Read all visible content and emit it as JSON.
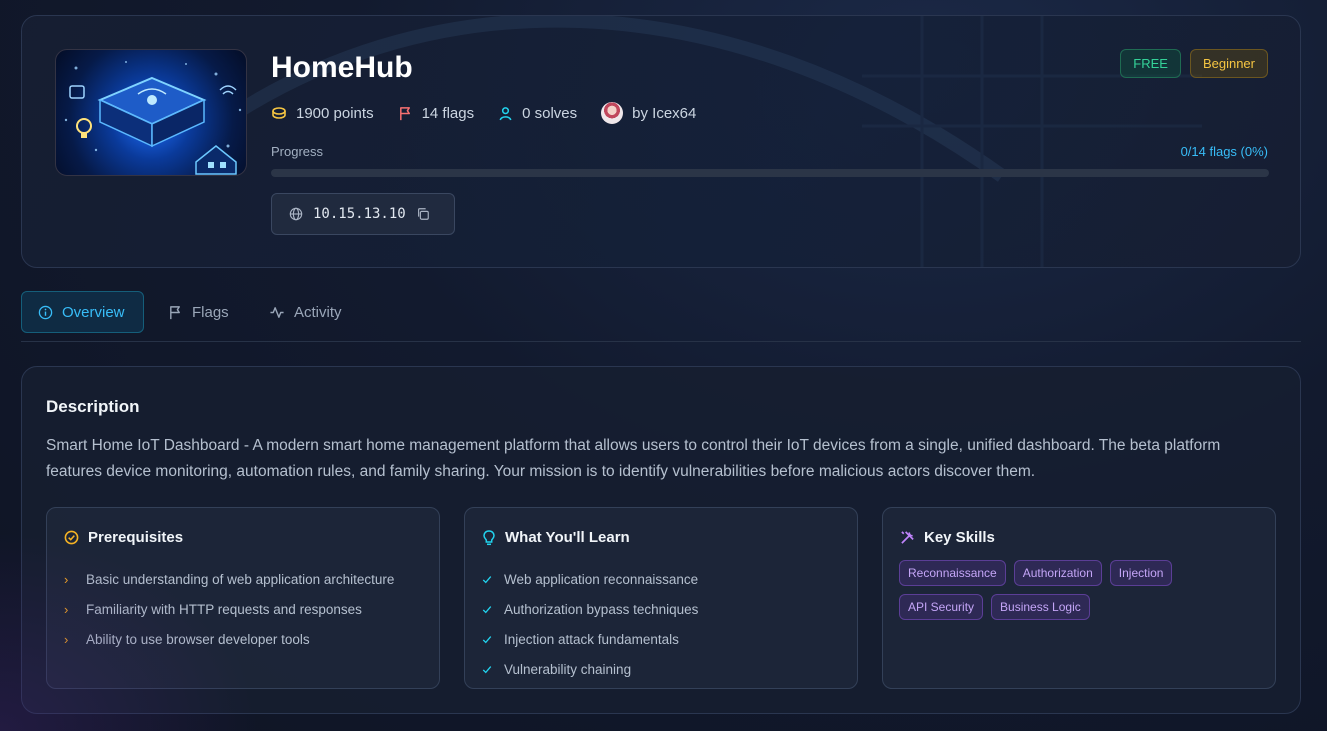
{
  "challenge": {
    "title": "HomeHub",
    "points": "1900 points",
    "flags": "14 flags",
    "solves": "0 solves",
    "author": "by Icex64",
    "badges": {
      "price": "FREE",
      "difficulty": "Beginner"
    },
    "progress": {
      "label": "Progress",
      "value_text": "0/14 flags (0%)",
      "fraction": 0
    },
    "ip": "10.15.13.10"
  },
  "tabs": [
    {
      "label": "Overview",
      "icon": "info-icon",
      "active": true
    },
    {
      "label": "Flags",
      "icon": "flag-icon",
      "active": false
    },
    {
      "label": "Activity",
      "icon": "activity-icon",
      "active": false
    }
  ],
  "description": {
    "title": "Description",
    "text": "Smart Home IoT Dashboard - A modern smart home management platform that allows users to control their IoT devices from a single, unified dashboard. The beta platform features device monitoring, automation rules, and family sharing. Your mission is to identify vulnerabilities before malicious actors discover them."
  },
  "prerequisites": {
    "title": "Prerequisites",
    "items": [
      "Basic understanding of web application architecture",
      "Familiarity with HTTP requests and responses",
      "Ability to use browser developer tools"
    ]
  },
  "learn": {
    "title": "What You'll Learn",
    "items": [
      "Web application reconnaissance",
      "Authorization bypass techniques",
      "Injection attack fundamentals",
      "Vulnerability chaining"
    ]
  },
  "skills": {
    "title": "Key Skills",
    "tags": [
      "Reconnaissance",
      "Authorization",
      "Injection",
      "API Security",
      "Business Logic"
    ]
  },
  "colors": {
    "accent": "#38bdf8",
    "free": "#34d399",
    "beginner": "#f5c542",
    "skill_tag": "#c4a5f7"
  }
}
